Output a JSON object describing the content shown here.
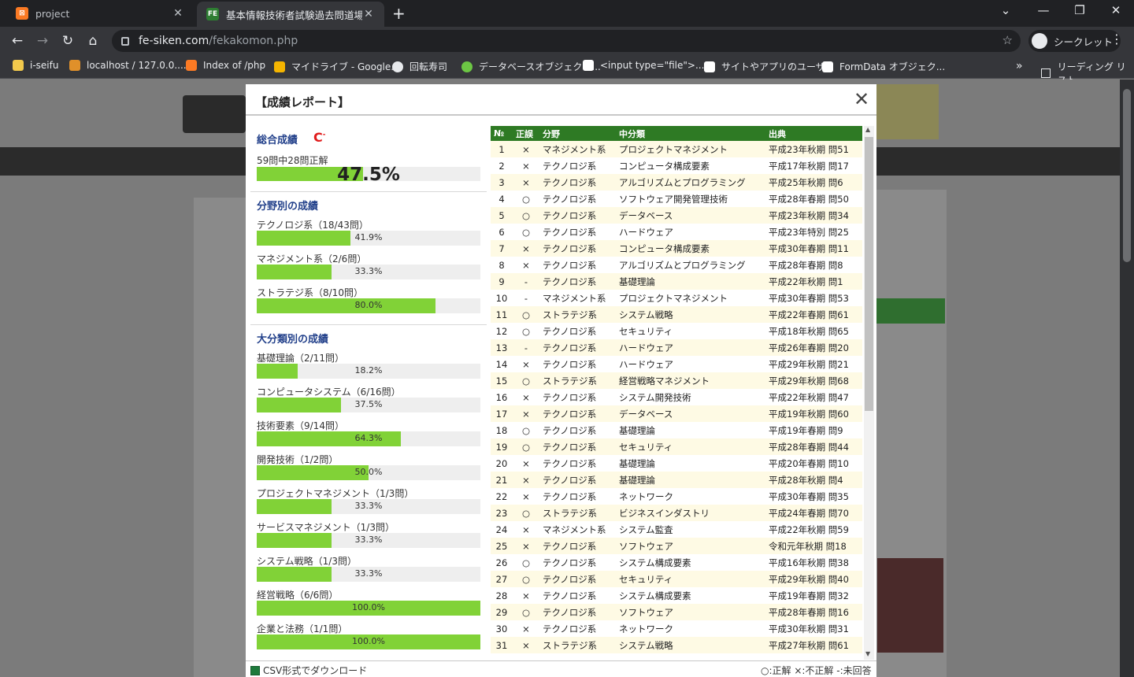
{
  "browser": {
    "tabs": [
      {
        "title": "project",
        "favicon": "xampp-icon"
      },
      {
        "title": "基本情報技術者試験過去問道場",
        "favicon": "fe-siken-icon"
      }
    ],
    "url_host": "fe-siken.com",
    "url_path": "/fekakomon.php",
    "incognito_label": "シークレット",
    "bookmarks": [
      {
        "label": "i-seifu",
        "icon": "folder-icon",
        "color": "#f2c94c"
      },
      {
        "label": "localhost / 127.0.0....",
        "icon": "phpmyadmin-icon",
        "color": "#e0902a"
      },
      {
        "label": "Index of /php",
        "icon": "xampp-icon",
        "color": "#fb7a24"
      },
      {
        "label": "マイドライブ - Google...",
        "icon": "drive-icon",
        "color": "#f4b400"
      },
      {
        "label": "回転寿司",
        "icon": "globe-icon",
        "color": "#e8eaed"
      },
      {
        "label": "データベースオブジェクト...",
        "icon": "site-icon",
        "color": "#6cc644"
      },
      {
        "label": "<input type=\"file\">...",
        "icon": "mdn-icon",
        "color": "#ffffff"
      },
      {
        "label": "サイトやアプリのユーザ...",
        "icon": "b-icon",
        "color": "#ffffff"
      },
      {
        "label": "FormData オブジェク...",
        "icon": "mdn-icon",
        "color": "#ffffff"
      }
    ],
    "reading_list": "リーディング リスト"
  },
  "modal": {
    "title": "【成績レポート】",
    "overall": {
      "title": "総合成績",
      "grade": "C",
      "summary": "59問中28問正解",
      "percent": "47.5%",
      "ratio": 0.475
    },
    "field_section_title": "分野別の成績",
    "fields": [
      {
        "label": "テクノロジ系（18/43問）",
        "percent": "41.9%",
        "ratio": 0.419
      },
      {
        "label": "マネジメント系（2/6問）",
        "percent": "33.3%",
        "ratio": 0.333
      },
      {
        "label": "ストラテジ系（8/10問）",
        "percent": "80.0%",
        "ratio": 0.8
      }
    ],
    "category_section_title": "大分類別の成績",
    "categories": [
      {
        "label": "基礎理論（2/11問）",
        "percent": "18.2%",
        "ratio": 0.182
      },
      {
        "label": "コンピュータシステム（6/16問）",
        "percent": "37.5%",
        "ratio": 0.375
      },
      {
        "label": "技術要素（9/14問）",
        "percent": "64.3%",
        "ratio": 0.643
      },
      {
        "label": "開発技術（1/2問）",
        "percent": "50.0%",
        "ratio": 0.5
      },
      {
        "label": "プロジェクトマネジメント（1/3問）",
        "percent": "33.3%",
        "ratio": 0.333
      },
      {
        "label": "サービスマネジメント（1/3問）",
        "percent": "33.3%",
        "ratio": 0.333
      },
      {
        "label": "システム戦略（1/3問）",
        "percent": "33.3%",
        "ratio": 0.333
      },
      {
        "label": "経営戦略（6/6問）",
        "percent": "100.0%",
        "ratio": 1.0
      },
      {
        "label": "企業と法務（1/1問）",
        "percent": "100.0%",
        "ratio": 1.0
      }
    ],
    "table": {
      "headers": [
        "№",
        "正誤",
        "分野",
        "中分類",
        "出典"
      ],
      "rows": [
        [
          "1",
          "×",
          "マネジメント系",
          "プロジェクトマネジメント",
          "平成23年秋期 問51"
        ],
        [
          "2",
          "×",
          "テクノロジ系",
          "コンピュータ構成要素",
          "平成17年秋期 問17"
        ],
        [
          "3",
          "×",
          "テクノロジ系",
          "アルゴリズムとプログラミング",
          "平成25年秋期 問6"
        ],
        [
          "4",
          "○",
          "テクノロジ系",
          "ソフトウェア開発管理技術",
          "平成28年春期 問50"
        ],
        [
          "5",
          "○",
          "テクノロジ系",
          "データベース",
          "平成23年秋期 問34"
        ],
        [
          "6",
          "○",
          "テクノロジ系",
          "ハードウェア",
          "平成23年特別 問25"
        ],
        [
          "7",
          "×",
          "テクノロジ系",
          "コンピュータ構成要素",
          "平成30年春期 問11"
        ],
        [
          "8",
          "×",
          "テクノロジ系",
          "アルゴリズムとプログラミング",
          "平成28年春期 問8"
        ],
        [
          "9",
          "-",
          "テクノロジ系",
          "基礎理論",
          "平成22年秋期 問1"
        ],
        [
          "10",
          "-",
          "マネジメント系",
          "プロジェクトマネジメント",
          "平成30年春期 問53"
        ],
        [
          "11",
          "○",
          "ストラテジ系",
          "システム戦略",
          "平成22年春期 問61"
        ],
        [
          "12",
          "○",
          "テクノロジ系",
          "セキュリティ",
          "平成18年秋期 問65"
        ],
        [
          "13",
          "-",
          "テクノロジ系",
          "ハードウェア",
          "平成26年春期 問20"
        ],
        [
          "14",
          "×",
          "テクノロジ系",
          "ハードウェア",
          "平成29年秋期 問21"
        ],
        [
          "15",
          "○",
          "ストラテジ系",
          "経営戦略マネジメント",
          "平成29年秋期 問68"
        ],
        [
          "16",
          "×",
          "テクノロジ系",
          "システム開発技術",
          "平成22年秋期 問47"
        ],
        [
          "17",
          "×",
          "テクノロジ系",
          "データベース",
          "平成19年秋期 問60"
        ],
        [
          "18",
          "○",
          "テクノロジ系",
          "基礎理論",
          "平成19年春期 問9"
        ],
        [
          "19",
          "○",
          "テクノロジ系",
          "セキュリティ",
          "平成28年春期 問44"
        ],
        [
          "20",
          "×",
          "テクノロジ系",
          "基礎理論",
          "平成20年春期 問10"
        ],
        [
          "21",
          "×",
          "テクノロジ系",
          "基礎理論",
          "平成28年秋期 問4"
        ],
        [
          "22",
          "×",
          "テクノロジ系",
          "ネットワーク",
          "平成30年春期 問35"
        ],
        [
          "23",
          "○",
          "ストラテジ系",
          "ビジネスインダストリ",
          "平成24年春期 問70"
        ],
        [
          "24",
          "×",
          "マネジメント系",
          "システム監査",
          "平成22年秋期 問59"
        ],
        [
          "25",
          "×",
          "テクノロジ系",
          "ソフトウェア",
          "令和元年秋期 問18"
        ],
        [
          "26",
          "○",
          "テクノロジ系",
          "システム構成要素",
          "平成16年秋期 問38"
        ],
        [
          "27",
          "○",
          "テクノロジ系",
          "セキュリティ",
          "平成29年秋期 問40"
        ],
        [
          "28",
          "×",
          "テクノロジ系",
          "システム構成要素",
          "平成19年春期 問32"
        ],
        [
          "29",
          "○",
          "テクノロジ系",
          "ソフトウェア",
          "平成28年春期 問16"
        ],
        [
          "30",
          "×",
          "テクノロジ系",
          "ネットワーク",
          "平成30年秋期 問31"
        ],
        [
          "31",
          "×",
          "ストラテジ系",
          "システム戦略",
          "平成27年秋期 問61"
        ]
      ]
    },
    "csv_label": "CSV形式でダウンロード",
    "legend": "○:正解 ×:不正解 -:未回答"
  },
  "colors": {
    "bar_fill": "#81d237",
    "table_header": "#2e7a24",
    "section_title": "#23418b",
    "grade": "#e01b1b"
  }
}
